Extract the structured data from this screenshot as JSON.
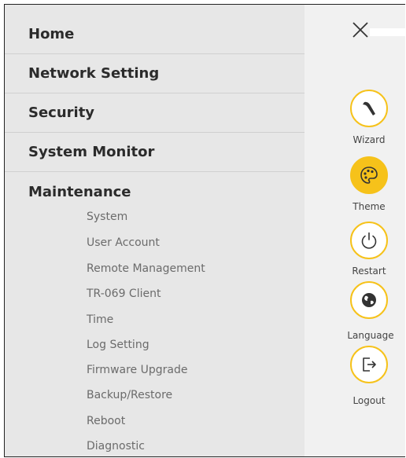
{
  "menu": {
    "items": [
      {
        "label": "Home"
      },
      {
        "label": "Network Setting"
      },
      {
        "label": "Security"
      },
      {
        "label": "System Monitor"
      },
      {
        "label": "Maintenance"
      }
    ],
    "maintenance_sub": [
      "System",
      "User Account",
      "Remote Management",
      "TR-069 Client",
      "Time",
      "Log Setting",
      "Firmware Upgrade",
      "Backup/Restore",
      "Reboot",
      "Diagnostic"
    ]
  },
  "side": {
    "wizard": "Wizard",
    "theme": "Theme",
    "restart": "Restart",
    "language": "Language",
    "logout": "Logout"
  },
  "icons": {
    "close": "close-icon",
    "wizard": "wand-icon",
    "theme": "palette-icon",
    "restart": "power-icon",
    "language": "globe-icon",
    "logout": "logout-icon"
  },
  "colors": {
    "accent": "#f6c21a",
    "menu_bg": "#e7e7e7",
    "side_bg": "#f1f1f1"
  }
}
